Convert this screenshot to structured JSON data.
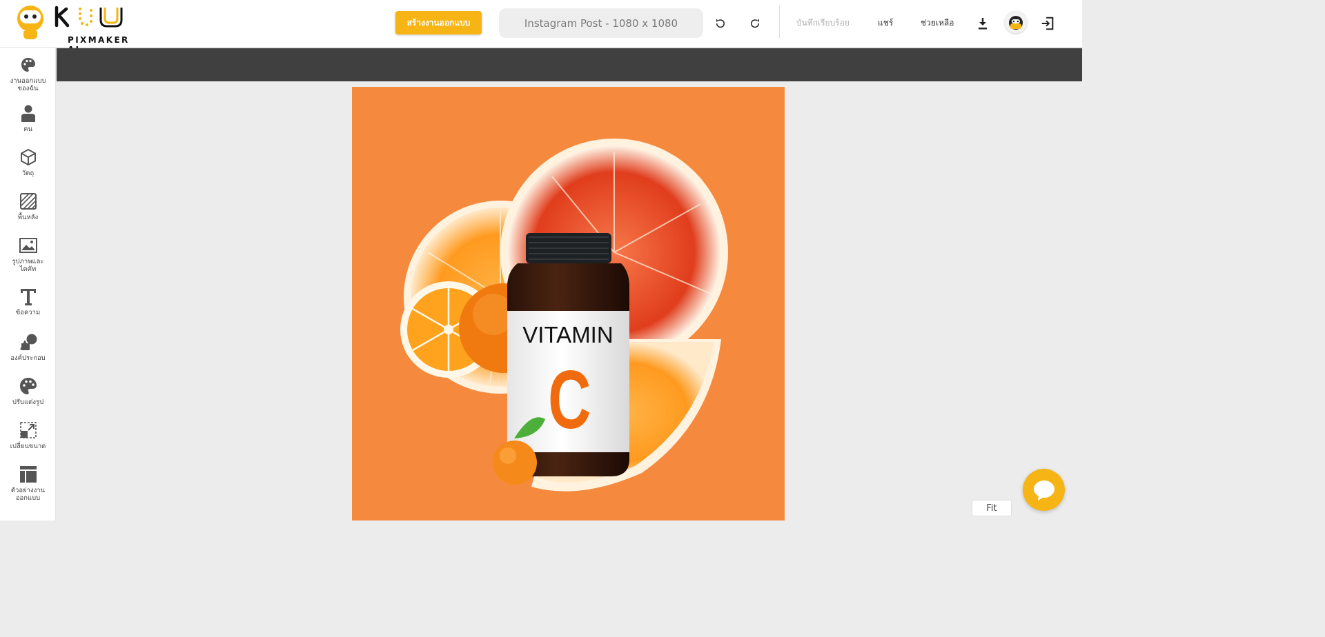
{
  "brand": {
    "name": "PIXMAKER AI",
    "accent": "#f7b415"
  },
  "header": {
    "create_button": "สร้างงานออกแบบ",
    "size_label": "Instagram Post - 1080 x 1080",
    "undo_icon": "undo-icon",
    "redo_icon": "redo-icon",
    "save_status": "บันทึกเรียบร้อย",
    "share": "แชร์",
    "help": "ช่วยเหลือ",
    "download_icon": "download-icon",
    "exit_icon": "exit-icon"
  },
  "sidebar": {
    "items": [
      {
        "label": "งานออกแบบ\nของฉัน",
        "icon": "palette-icon"
      },
      {
        "label": "คน",
        "icon": "person-icon"
      },
      {
        "label": "วัตถุ",
        "icon": "cube-icon"
      },
      {
        "label": "พื้นหลัง",
        "icon": "background-icon"
      },
      {
        "label": "รูปภาพและ\nไดคัท",
        "icon": "image-icon"
      },
      {
        "label": "ข้อความ",
        "icon": "text-icon"
      },
      {
        "label": "องค์ประกอบ",
        "icon": "shapes-icon"
      },
      {
        "label": "ปรับแต่งรูป",
        "icon": "adjust-icon"
      },
      {
        "label": "เปลี่ยนขนาด",
        "icon": "resize-icon"
      },
      {
        "label": "ตัวอย่างงาน\nออกแบบ",
        "icon": "template-icon"
      }
    ]
  },
  "canvas": {
    "background": "#f58a3f",
    "label_top": "VITAMIN",
    "label_big": "C"
  },
  "footer": {
    "fit": "Fit",
    "chat_icon": "chat-icon"
  }
}
